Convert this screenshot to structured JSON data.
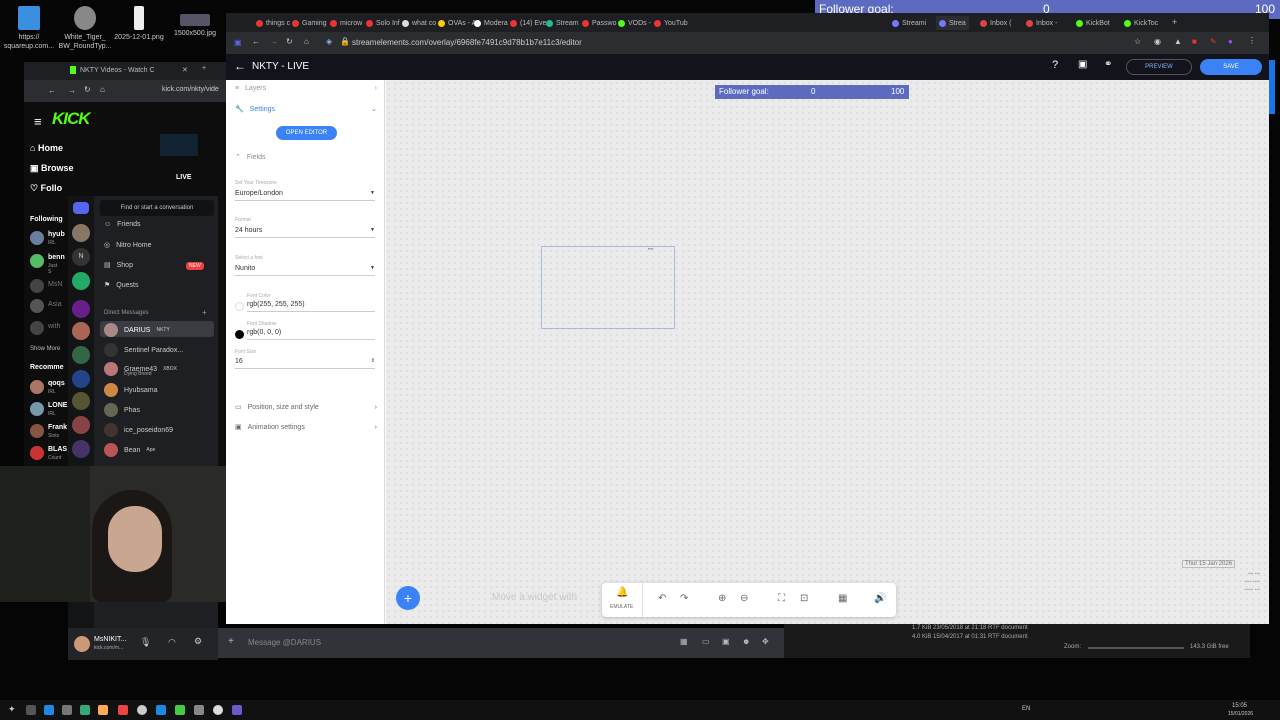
{
  "desktop_icons": [
    {
      "label": "https://\nsquareup.com..."
    },
    {
      "label": "White_Tiger_\nBW_RoundTyp..."
    },
    {
      "label": "2025-12-01.png"
    },
    {
      "label": "1500x500.jpg"
    }
  ],
  "overlay_goal": {
    "label": "Follower goal:",
    "current": "0",
    "target": "100"
  },
  "browser": {
    "tabs": [
      "things c",
      "Gaming",
      "microw",
      "Solo Inf",
      "what co",
      "OVAs - A",
      "Modera",
      "(14) Eve",
      "Stream",
      "Passwo",
      "VODs -",
      "YouTub",
      "Streami",
      "Strea",
      "Inbox (",
      "Inbox -",
      "KickBot",
      "KickToc"
    ],
    "url": "streamelements.com/overlay/6968fe7491c9d78b1b7e11c3/editor"
  },
  "editor": {
    "title": "NKTY - LIVE",
    "preview_label": "PREVIEW",
    "save_label": "SAVE",
    "layers_label": "Layers",
    "settings_label": "Settings",
    "open_editor_label": "OPEN EDITOR",
    "fields_label": "Fields",
    "timezone": {
      "label": "Set Your Timezone",
      "value": "Europe/London"
    },
    "format": {
      "label": "Format",
      "value": "24 hours"
    },
    "font": {
      "label": "Select a font",
      "value": "Nunito"
    },
    "font_color": {
      "label": "Font Color",
      "value": "rgb(255, 255, 255)"
    },
    "font_shadow": {
      "label": "Font Shadow",
      "value": "rgb(0, 0, 0)"
    },
    "font_size": {
      "label": "Font Size",
      "value": "16"
    },
    "position_label": "Position, size and style",
    "animation_label": "Animation settings",
    "widget_goal": {
      "label": "Follower goal:",
      "current": "0",
      "target": "100"
    },
    "move_hint": "Move a widget with",
    "emulate_label": "EMULATE",
    "date_text": "Thur 15 Jan 2026"
  },
  "kick": {
    "tab_title": "NKTY Videos - Watch C",
    "url": "kick.com/nkty/vide",
    "logo": "KICK",
    "nav": [
      "Home",
      "Browse",
      "Follo"
    ],
    "following_label": "Following",
    "following": [
      {
        "name": "hyub",
        "sub": "IRL"
      },
      {
        "name": "benn",
        "sub": "Just S"
      },
      {
        "name": "MsN",
        "sub": ""
      },
      {
        "name": "Asia",
        "sub": ""
      },
      {
        "name": "with",
        "sub": ""
      }
    ],
    "show_more": "Show More",
    "recommended_label": "Recomme",
    "recommended": [
      {
        "name": "qoqs",
        "sub": "IRL"
      },
      {
        "name": "LONE",
        "sub": "IRL"
      },
      {
        "name": "Frank",
        "sub": "Slots"
      },
      {
        "name": "BLAS",
        "sub": "Count"
      }
    ],
    "live_badge": "LIVE"
  },
  "discord": {
    "search": "Find or start a conversation",
    "menu": [
      {
        "label": "Friends"
      },
      {
        "label": "Nitro Home"
      },
      {
        "label": "Shop",
        "badge": "NEW"
      },
      {
        "label": "Quests"
      }
    ],
    "dm_header": "Direct Messages",
    "dms": [
      {
        "name": "DARIUS",
        "tag": "NKTY"
      },
      {
        "name": "Sentinel Paradox...",
        "tag": ""
      },
      {
        "name": "Graeme43",
        "tag": "XBOX"
      },
      {
        "name": "Hyubsama",
        "tag": ""
      },
      {
        "name": "Phas",
        "tag": ""
      },
      {
        "name": "ice_poseidon69",
        "tag": ""
      },
      {
        "name": "Bean",
        "tag": "Ape"
      }
    ],
    "sub_status": "Dying Breed",
    "message_placeholder": "Message @DARIUS",
    "user": "MsNIKIT...",
    "user_sub": "kick.com/m..."
  },
  "file_panel": {
    "row1": "1.7 KiB  23/05/2018 at 21:18  RTF document",
    "row2": "4.0 KiB  15/04/2017 at 01:31  RTF document",
    "zoom": "Zoom:",
    "free": "143.3 GiB free"
  },
  "taskbar": {
    "time": "15:05",
    "date": "15/01/2026",
    "lang": "EN"
  }
}
